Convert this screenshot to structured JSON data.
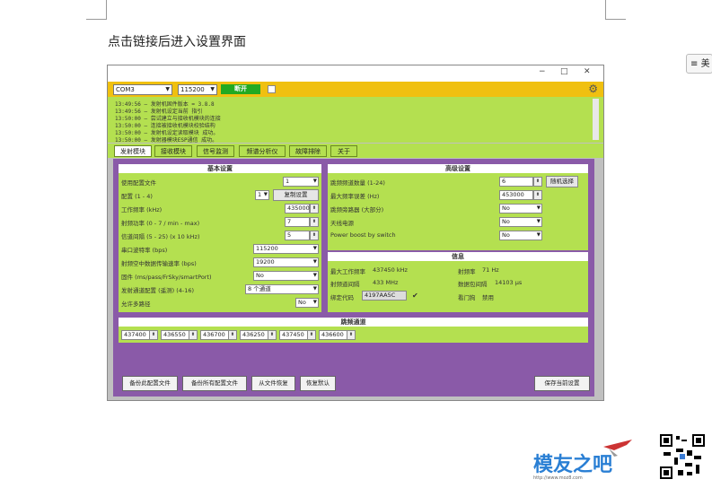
{
  "heading": "点击链接后进入设置界面",
  "side_tab": "美",
  "window": {
    "min": "−",
    "max": "□",
    "close": "✕"
  },
  "toolbar": {
    "port": "COM3",
    "baud": "115200",
    "connect": "断开",
    "gear_icon": "gear-icon"
  },
  "log": [
    "13:49:56 — 发射机固件版本 = 3.8.8",
    "13:49:56 — 发射机设定当前 指引",
    "13:50:00 — 尝试建立与接收机模块的连接",
    "13:50:00 — 连接被接收机模块校验结构",
    "13:50:00 — 发射机设定读取模块 成功。",
    "13:50:00 — 发射器模块ESP通信 成功。"
  ],
  "tabs": [
    "发射模块",
    "接收模块",
    "信号监测",
    "频谱分析仪",
    "故障排除",
    "关于"
  ],
  "basic": {
    "title": "基本设置",
    "rows": [
      {
        "label": "使用配置文件",
        "value": "1"
      },
      {
        "label": "配置 (1 - 4)",
        "value": "1",
        "button": "复制设置"
      },
      {
        "label": "工作频率 (kHz)",
        "value": "435000"
      },
      {
        "label": "射频功率 (0 - 7 / min - max)",
        "value": "7"
      },
      {
        "label": "信道间隔 (5 - 25) (x 10 kHz)",
        "value": "5"
      },
      {
        "label": "串口波特率 (bps)",
        "value": "115200"
      },
      {
        "label": "射频空中数据传输速率 (bps)",
        "value": "19200"
      },
      {
        "label": "固件 (ms/pass/FrSky/smartPort)",
        "value": "No"
      },
      {
        "label": "发射通道配置 (遥测) (4-16)",
        "value": "8 个通道"
      },
      {
        "label": "允许多路径",
        "value": "No"
      }
    ]
  },
  "advanced": {
    "title": "高级设置",
    "rows": [
      {
        "label": "跳频频道数量 (1-24)",
        "value": "6",
        "button": "随机选择"
      },
      {
        "label": "最大频率误差 (Hz)",
        "value": "453000"
      },
      {
        "label": "跳频旁路器 (大部分)",
        "value": "No"
      },
      {
        "label": "天线电源",
        "value": "No"
      },
      {
        "label": "Power boost by switch",
        "value": "No"
      }
    ]
  },
  "info": {
    "title": "信息",
    "max_freq_label": "最大工作频率",
    "max_freq": "437450 kHz",
    "freq_space_label": "射频道间隔",
    "freq_space": "433 MHz",
    "bind_label": "绑定代码",
    "bind_code": "4197AA5C",
    "noise_label": "射频率",
    "noise": "71 Hz",
    "packet_label": "数据包间隔",
    "packet": "14103 μs",
    "gate_label": "看门狗",
    "gate": "禁用"
  },
  "hop": {
    "title": "跳频通道",
    "values": [
      "437400",
      "436550",
      "436700",
      "436250",
      "437450",
      "436600"
    ]
  },
  "buttons": {
    "save_model": "备份此配置文件",
    "save_all": "备份所有配置文件",
    "restore": "从文件恢复",
    "reset": "恢复默认",
    "save_current": "保存当前设置"
  },
  "logo": {
    "brand": "模友之吧",
    "url": "http://www.moz8.com"
  }
}
